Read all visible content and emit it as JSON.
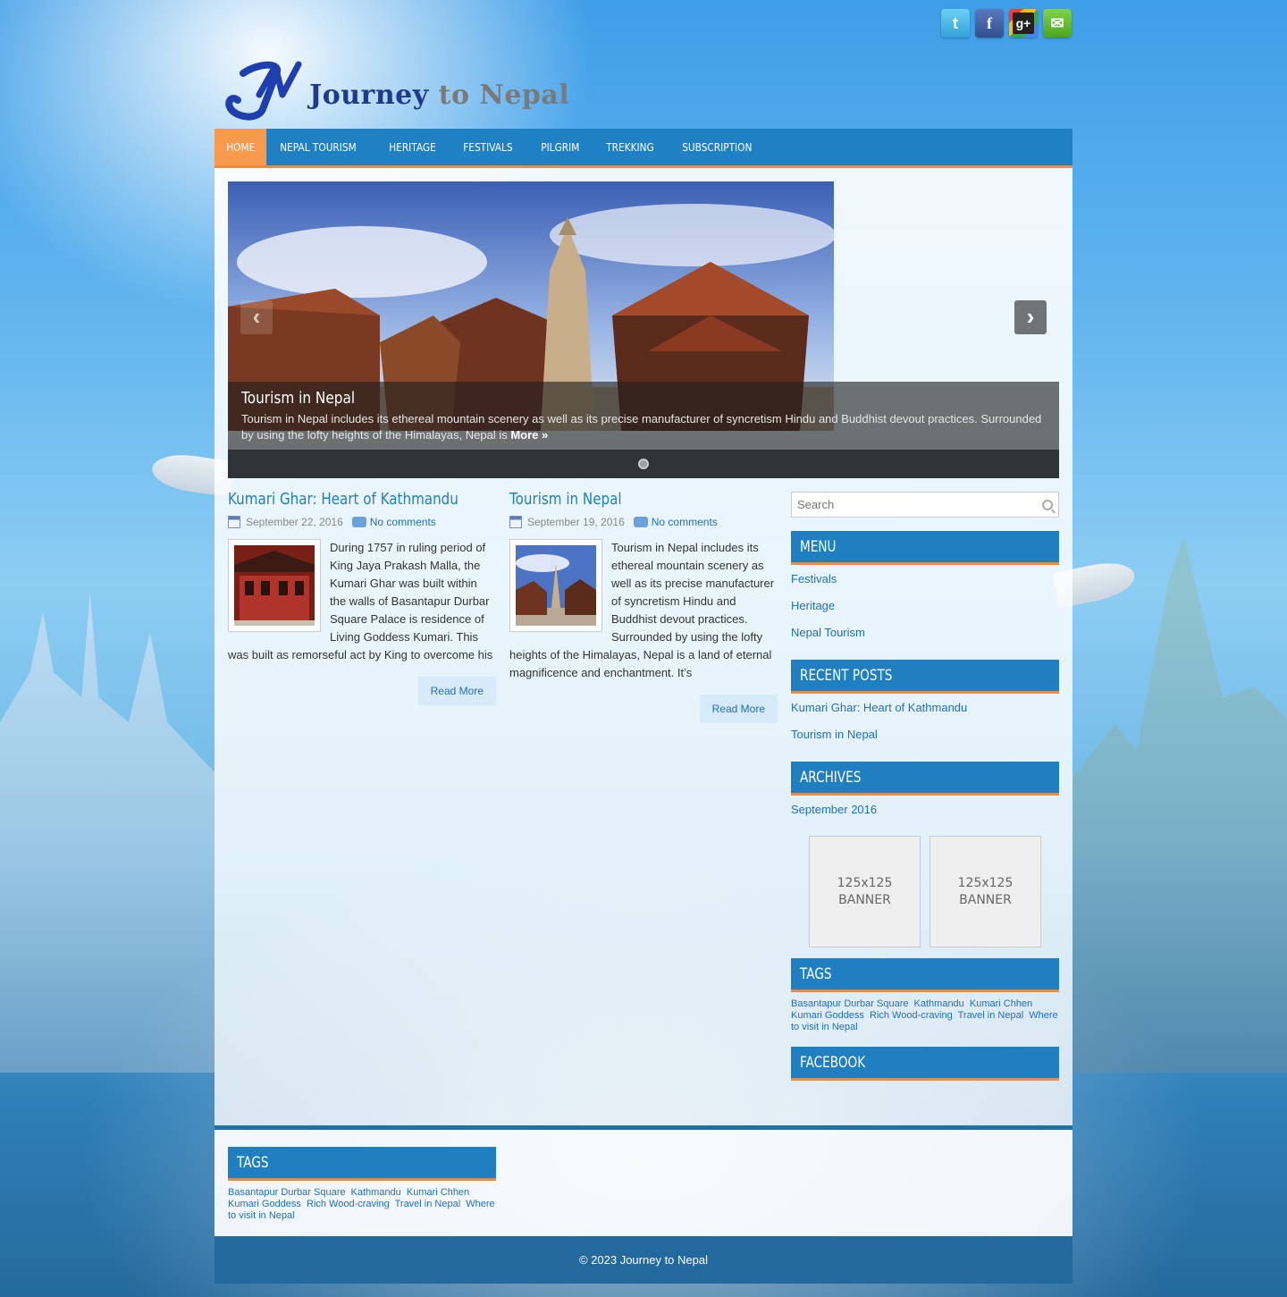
{
  "social": [
    {
      "name": "twitter",
      "icon": "twitter-icon"
    },
    {
      "name": "facebook",
      "icon": "facebook-icon"
    },
    {
      "name": "google-plus",
      "icon": "google-plus-icon"
    },
    {
      "name": "email",
      "icon": "email-icon"
    }
  ],
  "site": {
    "title_first": "Journey",
    "title_rest": " to Nepal"
  },
  "nav": {
    "items": [
      "Home",
      "Nepal Tourism",
      "Heritage",
      "Festivals",
      "Pilgrim",
      "Trekking",
      "Subscription"
    ],
    "active": "Home"
  },
  "slider": {
    "title": "Tourism in Nepal",
    "text": "Tourism in Nepal includes its ethereal mountain scenery as well as its precise manufacturer of syncretism Hindu and Buddhist devout practices. Surrounded by using the lofty heights of the Himalayas, Nepal is ",
    "more": "More »"
  },
  "posts": [
    {
      "title": "Kumari Ghar: Heart of Kathmandu",
      "date": "September 22, 2016",
      "comments": "No comments",
      "excerpt": "During 1757 in ruling period of King Jaya Prakash Malla, the Kumari Ghar was built within the walls of Basantapur Durbar Square Palace is residence of Living Goddess Kumari. This was built as remorseful act by King to overcome his",
      "read_more": "Read More"
    },
    {
      "title": "Tourism in Nepal",
      "date": "September 19, 2016",
      "comments": "No comments",
      "excerpt": "Tourism in Nepal includes its ethereal mountain scenery as well as its precise manufacturer of syncretism Hindu and Buddhist devout practices. Surrounded by using the lofty heights of the Himalayas, Nepal is a land of eternal magnificence and enchantment. It’s",
      "read_more": "Read More"
    }
  ],
  "sidebar": {
    "search_placeholder": "Search",
    "menu_title": "Menu",
    "menu_items": [
      "Festivals",
      "Heritage",
      "Nepal Tourism"
    ],
    "recent_title": "Recent Posts",
    "recent_items": [
      "Kumari Ghar: Heart of Kathmandu",
      "Tourism in Nepal"
    ],
    "archives_title": "Archives",
    "archives_items": [
      "September 2016"
    ],
    "banner_size": "125x125",
    "banner_label": "BANNER",
    "tags_title": "Tags",
    "tags": [
      "Basantapur Durbar Square",
      "Kathmandu",
      "Kumari Chhen",
      "Kumari Goddess",
      "Rich Wood-craving",
      "Travel in Nepal",
      "Where to visit in Nepal"
    ],
    "facebook_title": "Facebook"
  },
  "footer": {
    "tags_title": "Tags",
    "copyright": "© 2023 Journey to Nepal"
  },
  "colors": {
    "nav_bg": "#1f81c4",
    "nav_active": "#f89a4e",
    "accent_orange": "#f28a3a",
    "link_blue": "#1f6fbf"
  }
}
